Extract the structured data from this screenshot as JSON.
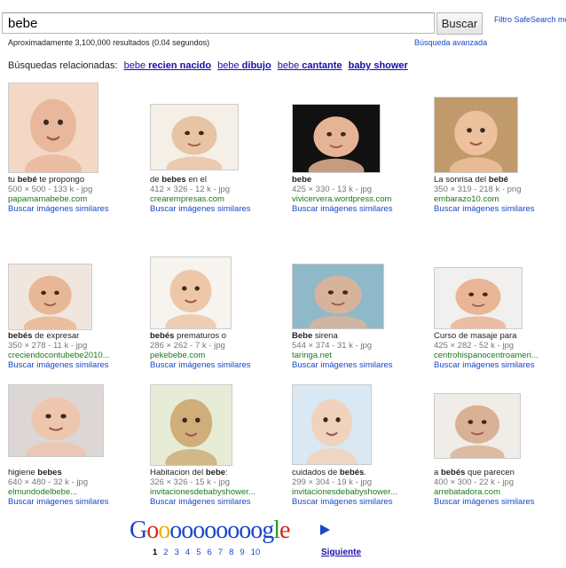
{
  "search": {
    "query": "bebe",
    "button": "Buscar",
    "safesearch": "Filtro SafeSearch mo"
  },
  "stats": {
    "results": "Aproximadamente 3,100,000 resultados (0.04 segundos)",
    "advanced": "Búsqueda avanzada"
  },
  "related": {
    "label": "Búsquedas relacionadas:",
    "items": [
      {
        "plain": "bebe",
        "bold": "recien nacido"
      },
      {
        "plain": "bebe",
        "bold": "dibujo"
      },
      {
        "plain": "bebe",
        "bold": "cantante"
      },
      {
        "plain": "",
        "bold": "baby shower"
      }
    ]
  },
  "results": [
    {
      "t_pre": "tu ",
      "t_bold": "bebé",
      "t_post": " te propongo",
      "meta": "500 × 500 - 133 k - jpg",
      "url": "papamamabebe.com",
      "similar": "Buscar imágenes similares"
    },
    {
      "t_pre": "de ",
      "t_bold": "bebes",
      "t_post": " en el",
      "meta": "412 × 326 - 12 k - jpg",
      "url": "crearempresas.com",
      "similar": "Buscar imágenes similares"
    },
    {
      "t_pre": "",
      "t_bold": "bebe",
      "t_post": "",
      "meta": "425 × 330 - 13 k - jpg",
      "url": "vivicervera.wordpress.com",
      "similar": "Buscar imágenes similares"
    },
    {
      "t_pre": "La sonrisa del ",
      "t_bold": "bebé",
      "t_post": "",
      "meta": "350 × 319 - 218 k - png",
      "url": "embarazo10.com",
      "similar": "Buscar imágenes similares"
    },
    {
      "t_pre": "",
      "t_bold": "bebés",
      "t_post": " de expresar",
      "meta": "350 × 278 - 11 k - jpg",
      "url": "creciendocontubebe2010...",
      "similar": "Buscar imágenes similares"
    },
    {
      "t_pre": "",
      "t_bold": "bebés",
      "t_post": " prematuros o",
      "meta": "286 × 262 - 7 k - jpg",
      "url": "pekebebe.com",
      "similar": "Buscar imágenes similares"
    },
    {
      "t_pre": "",
      "t_bold": "Bebe",
      "t_post": " sirena",
      "meta": "544 × 374 - 31 k - jpg",
      "url": "taringa.net",
      "similar": "Buscar imágenes similares"
    },
    {
      "t_pre": "Curso de masaje para",
      "t_bold": "",
      "t_post": "",
      "meta": "425 × 282 - 52 k - jpg",
      "url": "centrohispanocentroameri...",
      "similar": "Buscar imágenes similares"
    },
    {
      "t_pre": "higiene ",
      "t_bold": "bebes",
      "t_post": "",
      "meta": "640 × 480 - 32 k - jpg",
      "url": "elmundodelbebe...",
      "similar": "Buscar imágenes similares"
    },
    {
      "t_pre": "Habitacion del ",
      "t_bold": "bebe",
      "t_post": ":",
      "meta": "326 × 326 - 15 k - jpg",
      "url": "invitacionesdebabyshower...",
      "similar": "Buscar imágenes similares"
    },
    {
      "t_pre": "cuidados de ",
      "t_bold": "bebés",
      "t_post": ".",
      "meta": "299 × 304 - 19 k - jpg",
      "url": "invitacionesdebabyshower...",
      "similar": "Buscar imágenes similares"
    },
    {
      "t_pre": "a ",
      "t_bold": "bebés",
      "t_post": " que parecen",
      "meta": "400 × 300 - 22 k - jpg",
      "url": "arrebatadora.com",
      "similar": "Buscar imágenes similares"
    }
  ],
  "pager": {
    "logo": [
      {
        "ch": "G",
        "color": "#1a47c8"
      },
      {
        "ch": "o",
        "color": "#d02a1e"
      },
      {
        "ch": "o",
        "color": "#e8b000"
      },
      {
        "ch": "o",
        "color": "#1a47c8"
      },
      {
        "ch": "o",
        "color": "#1a47c8"
      },
      {
        "ch": "o",
        "color": "#1a47c8"
      },
      {
        "ch": "o",
        "color": "#1a47c8"
      },
      {
        "ch": "o",
        "color": "#1a47c8"
      },
      {
        "ch": "o",
        "color": "#1a47c8"
      },
      {
        "ch": "o",
        "color": "#1a47c8"
      },
      {
        "ch": "o",
        "color": "#1a47c8"
      },
      {
        "ch": "g",
        "color": "#1a47c8"
      },
      {
        "ch": "l",
        "color": "#2a9a2a"
      },
      {
        "ch": "e",
        "color": "#d02a1e"
      }
    ],
    "pages": [
      "1",
      "2",
      "3",
      "4",
      "5",
      "6",
      "7",
      "8",
      "9",
      "10"
    ],
    "current": "1",
    "next": "Siguiente"
  }
}
